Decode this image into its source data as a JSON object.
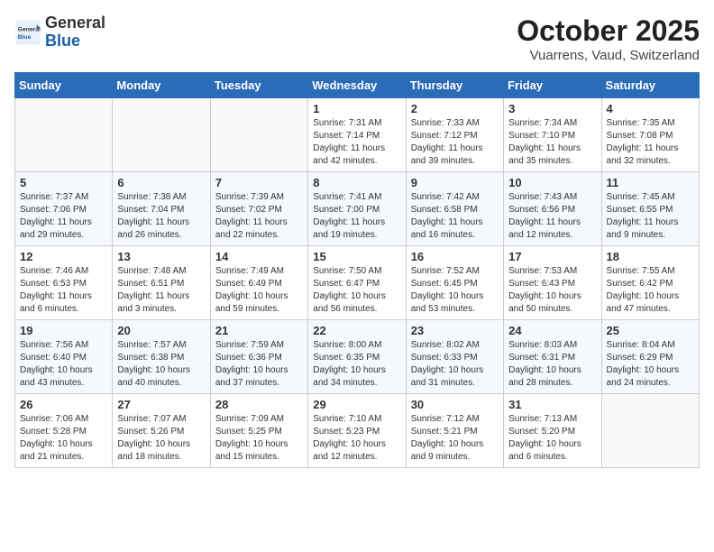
{
  "header": {
    "logo_general": "General",
    "logo_blue": "Blue",
    "month_title": "October 2025",
    "location": "Vuarrens, Vaud, Switzerland"
  },
  "weekdays": [
    "Sunday",
    "Monday",
    "Tuesday",
    "Wednesday",
    "Thursday",
    "Friday",
    "Saturday"
  ],
  "weeks": [
    [
      {
        "day": "",
        "info": ""
      },
      {
        "day": "",
        "info": ""
      },
      {
        "day": "",
        "info": ""
      },
      {
        "day": "1",
        "info": "Sunrise: 7:31 AM\nSunset: 7:14 PM\nDaylight: 11 hours\nand 42 minutes."
      },
      {
        "day": "2",
        "info": "Sunrise: 7:33 AM\nSunset: 7:12 PM\nDaylight: 11 hours\nand 39 minutes."
      },
      {
        "day": "3",
        "info": "Sunrise: 7:34 AM\nSunset: 7:10 PM\nDaylight: 11 hours\nand 35 minutes."
      },
      {
        "day": "4",
        "info": "Sunrise: 7:35 AM\nSunset: 7:08 PM\nDaylight: 11 hours\nand 32 minutes."
      }
    ],
    [
      {
        "day": "5",
        "info": "Sunrise: 7:37 AM\nSunset: 7:06 PM\nDaylight: 11 hours\nand 29 minutes."
      },
      {
        "day": "6",
        "info": "Sunrise: 7:38 AM\nSunset: 7:04 PM\nDaylight: 11 hours\nand 26 minutes."
      },
      {
        "day": "7",
        "info": "Sunrise: 7:39 AM\nSunset: 7:02 PM\nDaylight: 11 hours\nand 22 minutes."
      },
      {
        "day": "8",
        "info": "Sunrise: 7:41 AM\nSunset: 7:00 PM\nDaylight: 11 hours\nand 19 minutes."
      },
      {
        "day": "9",
        "info": "Sunrise: 7:42 AM\nSunset: 6:58 PM\nDaylight: 11 hours\nand 16 minutes."
      },
      {
        "day": "10",
        "info": "Sunrise: 7:43 AM\nSunset: 6:56 PM\nDaylight: 11 hours\nand 12 minutes."
      },
      {
        "day": "11",
        "info": "Sunrise: 7:45 AM\nSunset: 6:55 PM\nDaylight: 11 hours\nand 9 minutes."
      }
    ],
    [
      {
        "day": "12",
        "info": "Sunrise: 7:46 AM\nSunset: 6:53 PM\nDaylight: 11 hours\nand 6 minutes."
      },
      {
        "day": "13",
        "info": "Sunrise: 7:48 AM\nSunset: 6:51 PM\nDaylight: 11 hours\nand 3 minutes."
      },
      {
        "day": "14",
        "info": "Sunrise: 7:49 AM\nSunset: 6:49 PM\nDaylight: 10 hours\nand 59 minutes."
      },
      {
        "day": "15",
        "info": "Sunrise: 7:50 AM\nSunset: 6:47 PM\nDaylight: 10 hours\nand 56 minutes."
      },
      {
        "day": "16",
        "info": "Sunrise: 7:52 AM\nSunset: 6:45 PM\nDaylight: 10 hours\nand 53 minutes."
      },
      {
        "day": "17",
        "info": "Sunrise: 7:53 AM\nSunset: 6:43 PM\nDaylight: 10 hours\nand 50 minutes."
      },
      {
        "day": "18",
        "info": "Sunrise: 7:55 AM\nSunset: 6:42 PM\nDaylight: 10 hours\nand 47 minutes."
      }
    ],
    [
      {
        "day": "19",
        "info": "Sunrise: 7:56 AM\nSunset: 6:40 PM\nDaylight: 10 hours\nand 43 minutes."
      },
      {
        "day": "20",
        "info": "Sunrise: 7:57 AM\nSunset: 6:38 PM\nDaylight: 10 hours\nand 40 minutes."
      },
      {
        "day": "21",
        "info": "Sunrise: 7:59 AM\nSunset: 6:36 PM\nDaylight: 10 hours\nand 37 minutes."
      },
      {
        "day": "22",
        "info": "Sunrise: 8:00 AM\nSunset: 6:35 PM\nDaylight: 10 hours\nand 34 minutes."
      },
      {
        "day": "23",
        "info": "Sunrise: 8:02 AM\nSunset: 6:33 PM\nDaylight: 10 hours\nand 31 minutes."
      },
      {
        "day": "24",
        "info": "Sunrise: 8:03 AM\nSunset: 6:31 PM\nDaylight: 10 hours\nand 28 minutes."
      },
      {
        "day": "25",
        "info": "Sunrise: 8:04 AM\nSunset: 6:29 PM\nDaylight: 10 hours\nand 24 minutes."
      }
    ],
    [
      {
        "day": "26",
        "info": "Sunrise: 7:06 AM\nSunset: 5:28 PM\nDaylight: 10 hours\nand 21 minutes."
      },
      {
        "day": "27",
        "info": "Sunrise: 7:07 AM\nSunset: 5:26 PM\nDaylight: 10 hours\nand 18 minutes."
      },
      {
        "day": "28",
        "info": "Sunrise: 7:09 AM\nSunset: 5:25 PM\nDaylight: 10 hours\nand 15 minutes."
      },
      {
        "day": "29",
        "info": "Sunrise: 7:10 AM\nSunset: 5:23 PM\nDaylight: 10 hours\nand 12 minutes."
      },
      {
        "day": "30",
        "info": "Sunrise: 7:12 AM\nSunset: 5:21 PM\nDaylight: 10 hours\nand 9 minutes."
      },
      {
        "day": "31",
        "info": "Sunrise: 7:13 AM\nSunset: 5:20 PM\nDaylight: 10 hours\nand 6 minutes."
      },
      {
        "day": "",
        "info": ""
      }
    ]
  ]
}
